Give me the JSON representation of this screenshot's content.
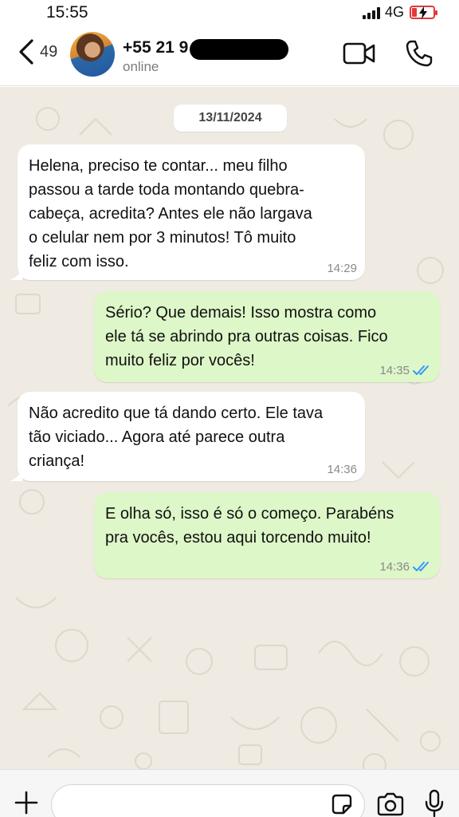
{
  "status_bar": {
    "time": "15:55",
    "network": "4G",
    "battery_level": 0.15,
    "battery_color": "#e23a3a"
  },
  "header": {
    "back_count": "49",
    "contact_name": "+55 21 9",
    "contact_status": "online",
    "icons": [
      "chevron-left-icon",
      "avatar",
      "video-call-icon",
      "phone-icon"
    ]
  },
  "chat": {
    "date": "13/11/2024",
    "wallpaper_color": "#efeae2",
    "messages": [
      {
        "direction": "incoming",
        "text": "Helena, preciso te contar... meu filho\npassou a tarde toda montando quebra-\ncabeça, acredita? Antes ele não largava\no celular nem por 3 minutos! Tô muito\nfeliz com isso.",
        "time": "14:29"
      },
      {
        "direction": "outgoing",
        "text": "Sério? Que demais! Isso mostra como\nele tá se abrindo pra outras coisas. Fico\nmuito feliz por vocês!",
        "time": "14:35",
        "status": "read"
      },
      {
        "direction": "incoming",
        "text": "Não acredito que tá dando certo. Ele tava\ntão viciado... Agora até parece outra\ncriança!",
        "time": "14:36"
      },
      {
        "direction": "outgoing",
        "text": "E olha só, isso é só o começo. Parabéns\npra vocês, estou aqui torcendo muito!",
        "time": "14:36",
        "status": "read"
      }
    ]
  },
  "input_bar": {
    "message_value": "",
    "icons": [
      "plus-icon",
      "sticker-icon",
      "camera-icon",
      "microphone-icon"
    ]
  },
  "colors": {
    "incoming_bubble": "#ffffff",
    "outgoing_bubble": "#ddf7c8",
    "read_ticks": "#3497f9"
  }
}
